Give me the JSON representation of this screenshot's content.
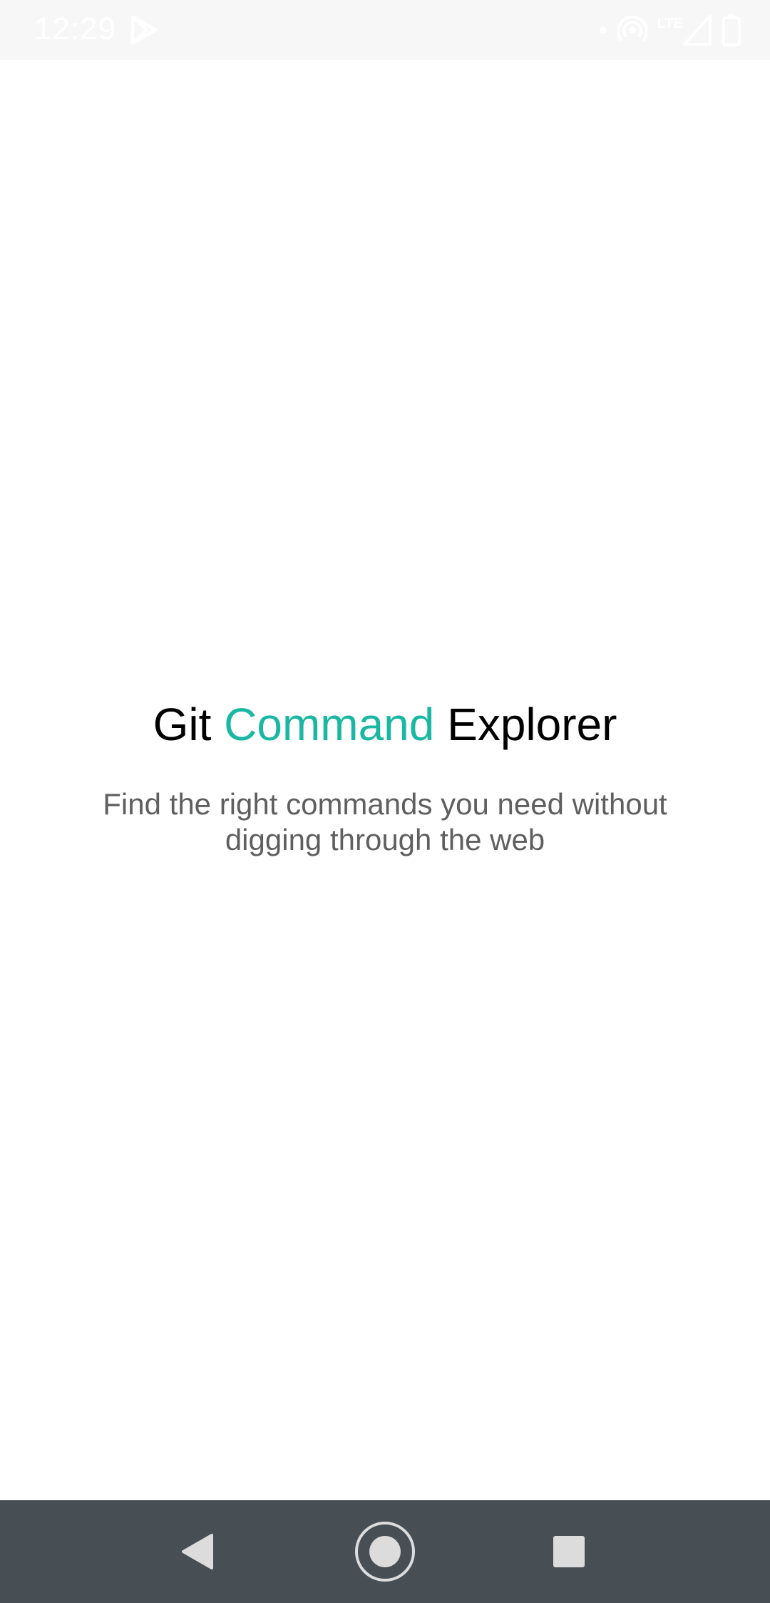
{
  "status_bar": {
    "time": "12:29",
    "network_label": "LTE",
    "icons": [
      "play-store-icon",
      "dot-icon",
      "hotspot-icon",
      "signal-icon",
      "battery-icon"
    ]
  },
  "app": {
    "title_part1": "Git",
    "title_part2": "Command",
    "title_part3": "Explorer",
    "subtitle": "Find the right commands you need without digging through the web",
    "accent_color": "#1ab7a2"
  },
  "nav_bar": {
    "buttons": [
      "back-icon",
      "home-icon",
      "recents-icon"
    ]
  }
}
